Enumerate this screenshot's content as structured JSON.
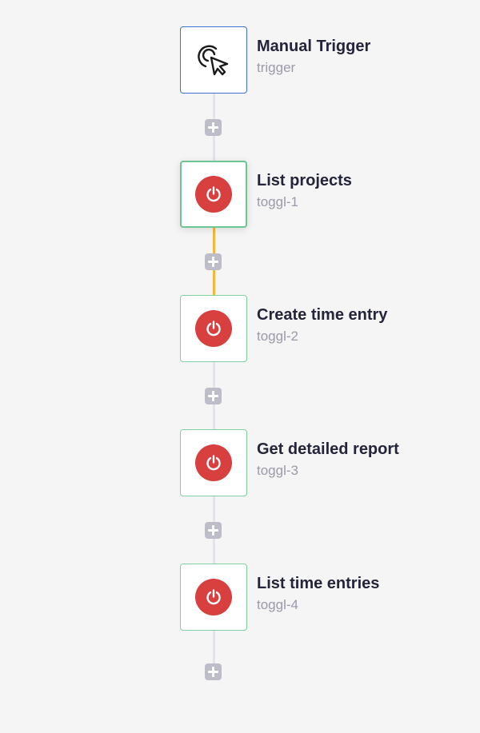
{
  "workflow": {
    "nodes": [
      {
        "title": "Manual Trigger",
        "subtitle": "trigger",
        "icon": "cursor-click-icon",
        "kind": "trigger"
      },
      {
        "title": "List projects",
        "subtitle": "toggl-1",
        "icon": "power-icon",
        "kind": "action",
        "selected": true,
        "app_color": "#d83f3f"
      },
      {
        "title": "Create time entry",
        "subtitle": "toggl-2",
        "icon": "power-icon",
        "kind": "action",
        "app_color": "#d83f3f"
      },
      {
        "title": "Get detailed report",
        "subtitle": "toggl-3",
        "icon": "power-icon",
        "kind": "action",
        "app_color": "#d83f3f"
      },
      {
        "title": "List time entries",
        "subtitle": "toggl-4",
        "icon": "power-icon",
        "kind": "action",
        "app_color": "#d83f3f"
      }
    ],
    "add_step_icon": "plus-icon",
    "colors": {
      "background": "#f5f5f5",
      "connector": "#e4e4e8",
      "connector_active": "#f4b73e",
      "trigger_border": "#3f6fcf",
      "action_border": "#7fd1a0",
      "add_button": "#bdbdc9"
    }
  }
}
